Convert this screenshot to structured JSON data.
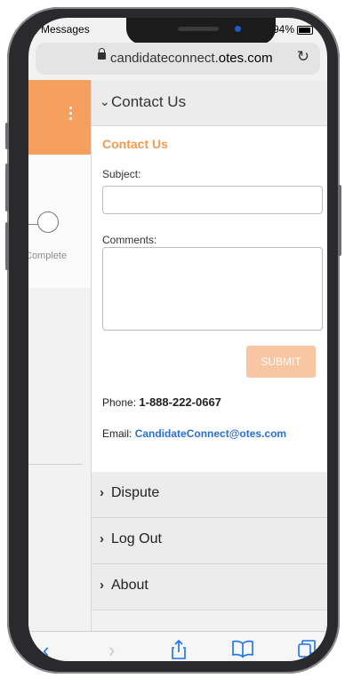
{
  "status": {
    "left_text": "Messages",
    "right_text": "94%"
  },
  "browser": {
    "domain_prefix": "candidateconnect.",
    "domain_main": "otes.com",
    "reload_icon": "reload-icon"
  },
  "left": {
    "step_label": "Complete"
  },
  "drawer": {
    "header_label": "Contact Us",
    "contact": {
      "title": "Contact Us",
      "subject_label": "Subject:",
      "subject_value": "",
      "comments_label": "Comments:",
      "comments_value": "",
      "submit_label": "SUBMIT",
      "phone_label": "Phone:",
      "phone_value": "1-888-222-0667",
      "email_label": "Email:",
      "email_value": "CandidateConnect@otes.com"
    },
    "items": [
      {
        "label": "Dispute"
      },
      {
        "label": "Log Out"
      },
      {
        "label": "About"
      }
    ]
  },
  "colors": {
    "accent": "#f5a05e",
    "link": "#2a6fd6",
    "submit_bg": "#f8c6a2"
  }
}
